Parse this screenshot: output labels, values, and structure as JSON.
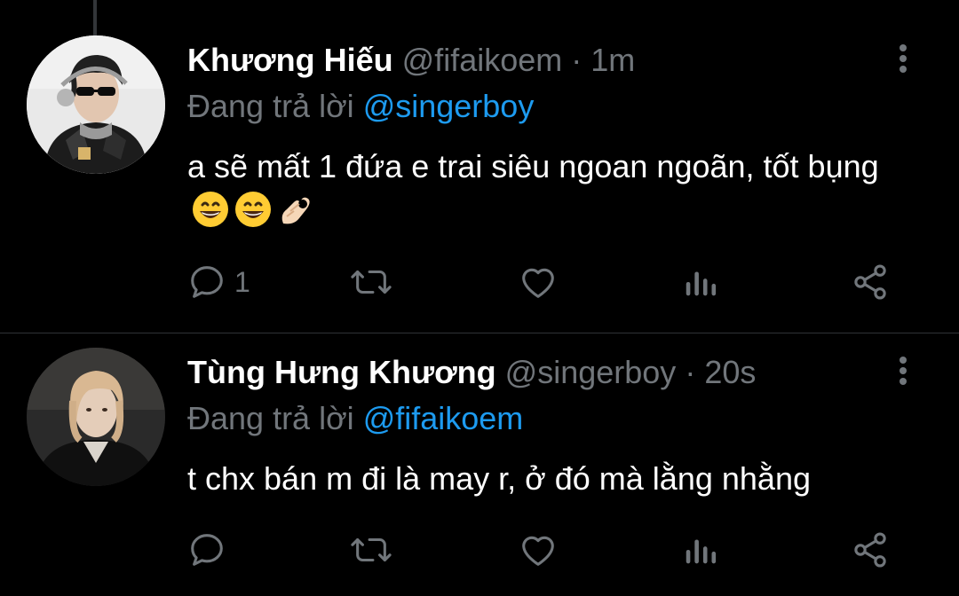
{
  "tweets": [
    {
      "display_name": "Khương Hiếu",
      "handle": "@fifaikoem",
      "separator": " · ",
      "time": "1m",
      "reply_prefix": "Đang trả lời ",
      "reply_to": "@singerboy",
      "text": "a sẽ mất 1 đứa e trai siêu ngoan ngoãn, tốt bụng",
      "emojis": [
        "grinning-face-emoji",
        "grinning-face-emoji",
        "ok-hand-emoji"
      ],
      "reply_count": "1",
      "retweet_count": "",
      "like_count": ""
    },
    {
      "display_name": "Tùng Hưng Khương",
      "handle": "@singerboy",
      "separator": " · ",
      "time": "20s",
      "reply_prefix": "Đang trả lời ",
      "reply_to": "@fifaikoem",
      "text": "t chx bán m đi là may r, ở đó mà lằng nhằng",
      "reply_count": "",
      "retweet_count": "",
      "like_count": ""
    }
  ],
  "icons": {
    "reply": "reply-icon",
    "retweet": "retweet-icon",
    "like": "heart-icon",
    "views": "views-icon",
    "share": "share-icon",
    "more": "more-options-icon"
  },
  "colors": {
    "background": "#000000",
    "primary_text": "#ffffff",
    "secondary_text": "#71767b",
    "mention": "#1d9bf0",
    "divider": "#2f3336"
  }
}
